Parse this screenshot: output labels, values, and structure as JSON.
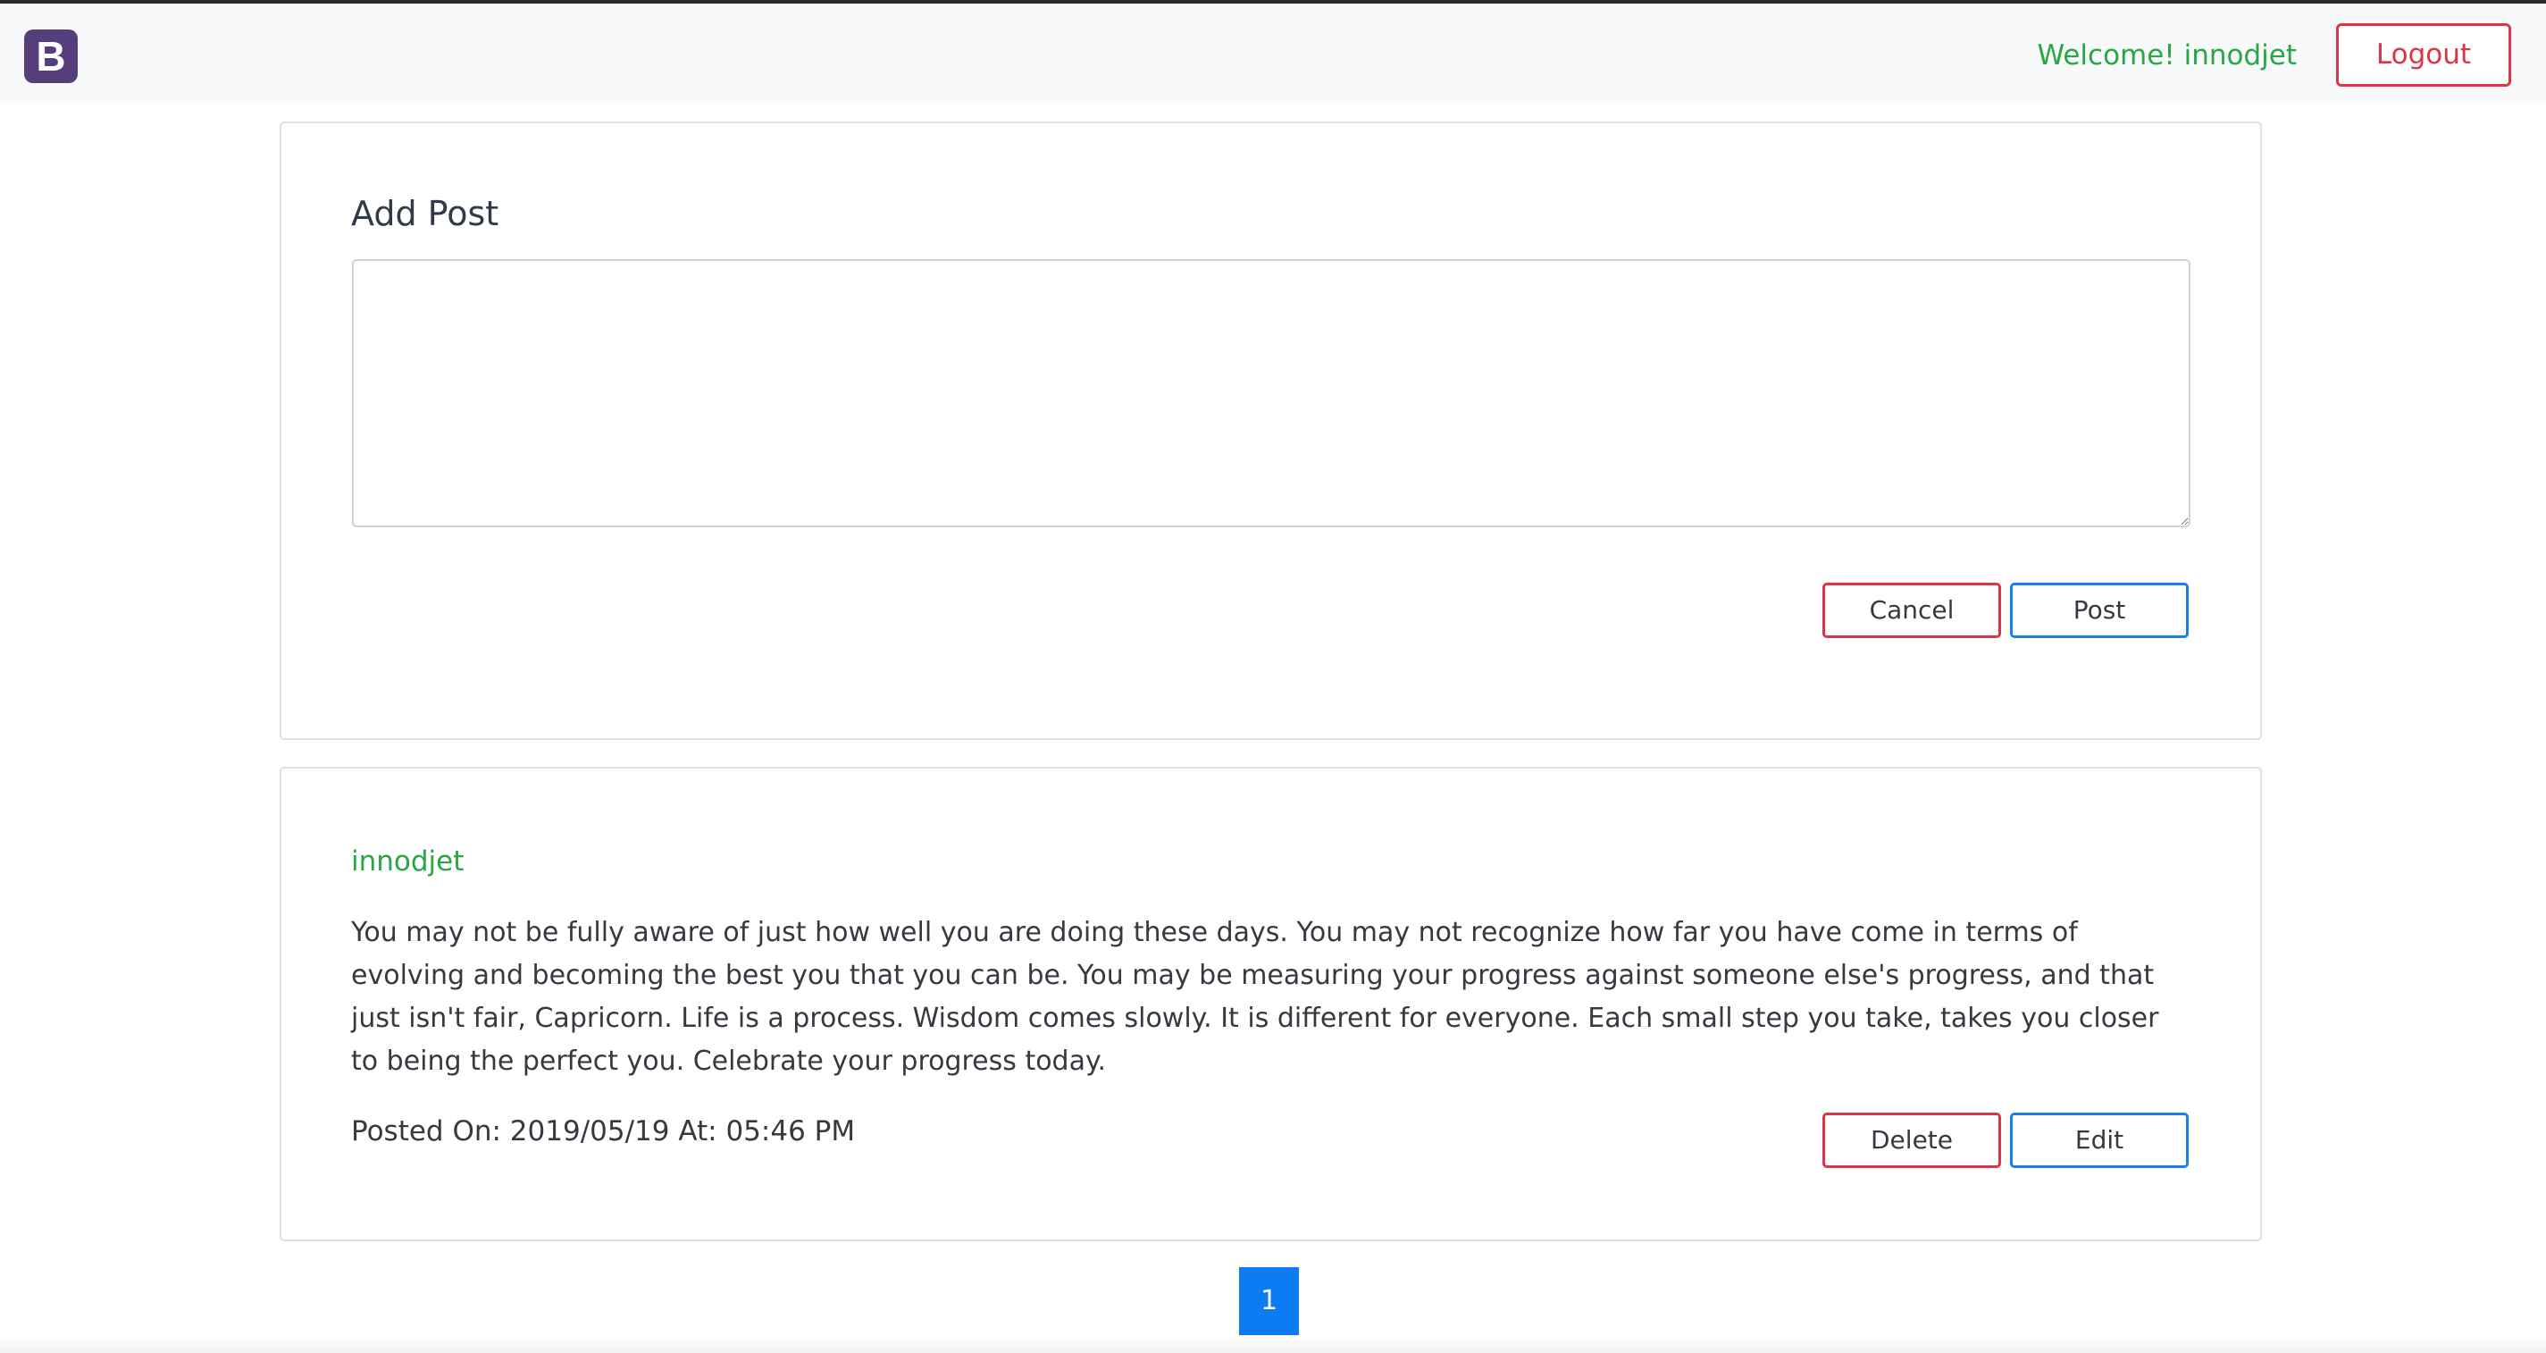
{
  "navbar": {
    "brand_letter": "B",
    "welcome_text": "Welcome! innodjet",
    "logout_label": "Logout"
  },
  "add_post": {
    "title": "Add Post",
    "textarea_value": "",
    "cancel_label": "Cancel",
    "post_label": "Post"
  },
  "posts": [
    {
      "author": "innodjet",
      "body": "You may not be fully aware of just how well you are doing these days. You may not recognize how far you have come in terms of evolving and becoming the best you that you can be. You may be measuring your progress against someone else's progress, and that just isn't fair, Capricorn. Life is a process. Wisdom comes slowly. It is different for everyone. Each small step you take, takes you closer to being the perfect you. Celebrate your progress today.",
      "posted_on": "Posted On: 2019/05/19 At: 05:46 PM",
      "delete_label": "Delete",
      "edit_label": "Edit"
    }
  ],
  "pagination": {
    "current_page": "1"
  },
  "colors": {
    "brand": "#563d7c",
    "success": "#28a745",
    "danger": "#dc3545",
    "primary": "#1a7fe6",
    "page_active": "#0d7cf2"
  }
}
